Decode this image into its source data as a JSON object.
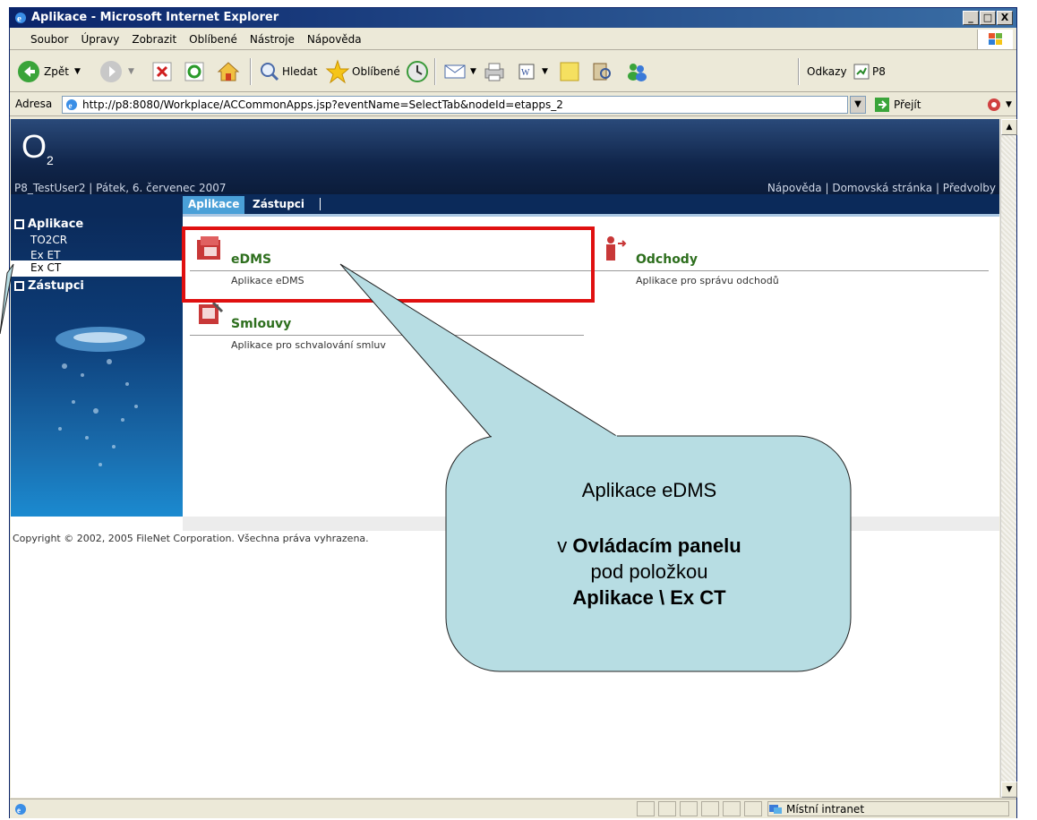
{
  "window": {
    "title": "Aplikace - Microsoft Internet Explorer",
    "controls": [
      "_",
      "□",
      "X"
    ]
  },
  "menu": [
    "Soubor",
    "Úpravy",
    "Zobrazit",
    "Oblíbené",
    "Nástroje",
    "Nápověda"
  ],
  "toolbar": {
    "back_label": "Zpět",
    "search_label": "Hledat",
    "favorites_label": "Oblíbené",
    "links_label": "Odkazy",
    "link_p8": "P8"
  },
  "address": {
    "label": "Adresa",
    "url": "http://p8:8080/Workplace/ACCommonApps.jsp?eventName=SelectTab&nodeId=etapps_2",
    "go_label": "Přejít"
  },
  "header": {
    "logo": "O",
    "logo_sub": "2",
    "user_line": "P8_TestUser2 | Pátek, 6. červenec 2007",
    "top_links": "Nápověda | Domovská stránka | Předvolby"
  },
  "tabs": [
    "Aplikace",
    "Zástupci"
  ],
  "sidebar": {
    "section1": "Aplikace",
    "items": [
      "TO2CR",
      "Ex ET",
      "Ex CT"
    ],
    "section2": "Zástupci"
  },
  "apps": [
    {
      "title": "eDMS",
      "desc": "Aplikace eDMS"
    },
    {
      "title": "Odchody",
      "desc": "Aplikace pro správu odchodů"
    },
    {
      "title": "Smlouvy",
      "desc": "Aplikace pro schvalování smluv"
    }
  ],
  "copyright": "Copyright © 2002, 2005 FileNet Corporation. Všechna práva vyhrazena.",
  "status": {
    "zone": "Místní intranet"
  },
  "callout": {
    "line1": "Aplikace eDMS",
    "line2_prefix": "v ",
    "line2_bold": "Ovládacím panelu",
    "line3": "pod položkou",
    "line4": "Aplikace \\ Ex CT"
  },
  "colors": {
    "highlight": "#e01010",
    "callout_fill": "#b7dde3",
    "app_title": "#2e6f1e"
  }
}
